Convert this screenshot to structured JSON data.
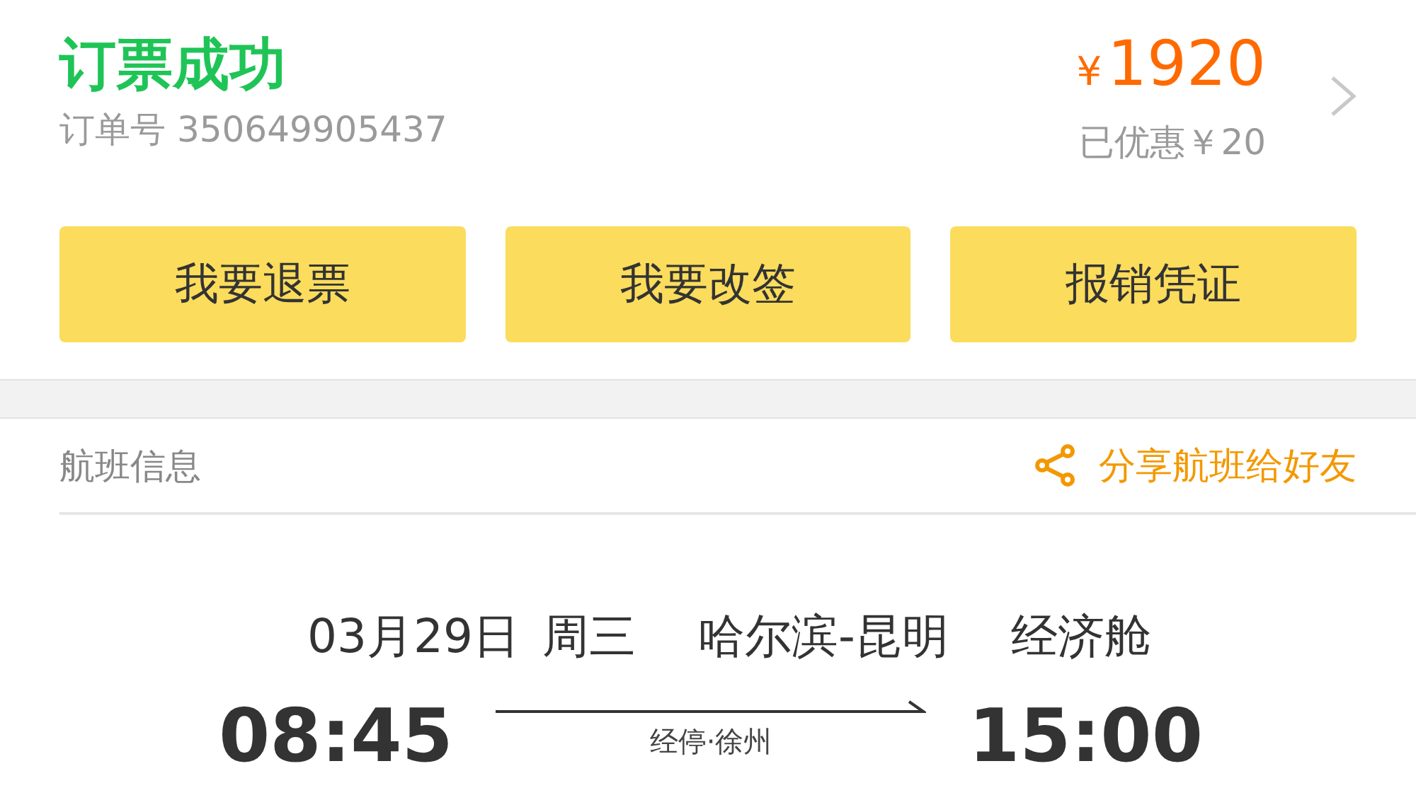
{
  "order": {
    "status": "订票成功",
    "order_number": "订单号 350649905437"
  },
  "price": {
    "currency": "¥",
    "amount": "1920",
    "discount": "已优惠￥20"
  },
  "buttons": [
    "我要退票",
    "我要改签",
    "报销凭证"
  ],
  "section": {
    "title": "航班信息",
    "share": "分享航班给好友"
  },
  "flight": {
    "date": "03月29日",
    "weekday": "周三",
    "route": "哈尔滨-昆明",
    "cabin": "经济舱",
    "departure": "08:45",
    "stop": "经停·徐州",
    "arrival": "15:00"
  }
}
